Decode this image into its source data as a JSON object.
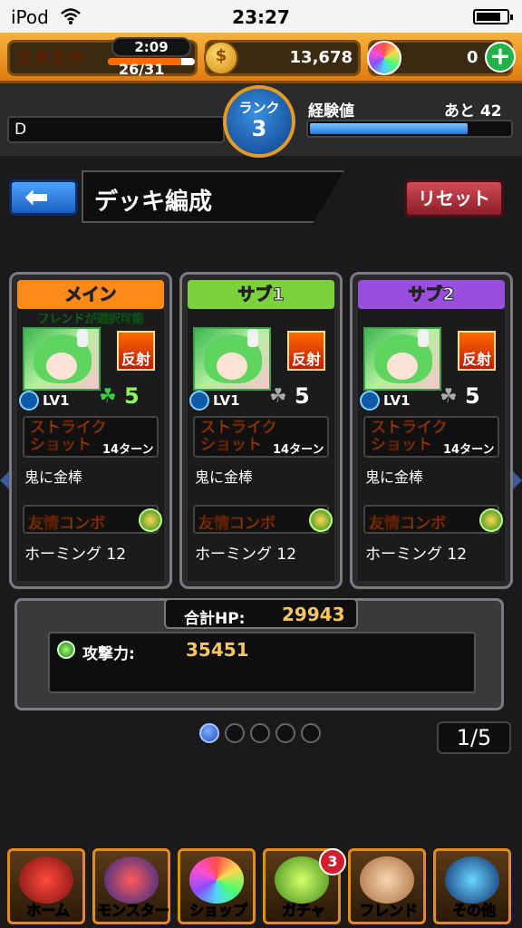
{
  "status_bar": {
    "carrier": "iPod",
    "time": "23:27"
  },
  "hud": {
    "stamina_label": "スタミナ",
    "stamina_timer": "2:09",
    "stamina_value": "26/31",
    "stamina_fill": 0.84,
    "coins": "13,678",
    "orbs": "0",
    "plus": "+"
  },
  "rank": {
    "label": "ランク",
    "value": "3",
    "player_name": "D",
    "exp_label": "経験値",
    "exp_remaining": "あと 42",
    "exp_fill": 0.79
  },
  "header": {
    "back": "⬅",
    "title": "デッキ編成",
    "reset": "リセット"
  },
  "slots": [
    {
      "header": "メイン",
      "friend_note": "フレンドが選択可能",
      "reflect": "反射",
      "level": "LV1",
      "luck": "5",
      "strike_label": "ストライクショット",
      "turns": "14ターン",
      "skill": "鬼に金棒",
      "combo_label": "友情コンボ",
      "combo": "ホーミング 12"
    },
    {
      "header": "サブ1",
      "reflect": "反射",
      "level": "LV1",
      "luck": "5",
      "strike_label": "ストライクショット",
      "turns": "14ターン",
      "skill": "鬼に金棒",
      "combo_label": "友情コンボ",
      "combo": "ホーミング 12"
    },
    {
      "header": "サブ2",
      "reflect": "反射",
      "level": "LV1",
      "luck": "5",
      "strike_label": "ストライクショット",
      "turns": "14ターン",
      "skill": "鬼に金棒",
      "combo_label": "友情コンボ",
      "combo": "ホーミング 12"
    }
  ],
  "stats": {
    "hp_label": "合計HP:",
    "hp": "29943",
    "atk_label": "攻撃力:",
    "atk": "35451"
  },
  "pager": {
    "current": 1,
    "total": 5,
    "text": "1/5"
  },
  "nav": [
    {
      "label": "ホーム",
      "icon": "dragon-icon"
    },
    {
      "label": "モンスター",
      "icon": "monster-icon"
    },
    {
      "label": "ショップ",
      "icon": "orb-icon"
    },
    {
      "label": "ガチャ",
      "icon": "egg-icon",
      "badge": "3"
    },
    {
      "label": "フレンド",
      "icon": "handshake-icon"
    },
    {
      "label": "その他",
      "icon": "radar-icon"
    }
  ],
  "colors": {
    "main_header": "#ff8a1a",
    "sub1_header": "#7bd23a",
    "sub2_header": "#9a4ee0",
    "accent_gold": "#f7c65e"
  }
}
